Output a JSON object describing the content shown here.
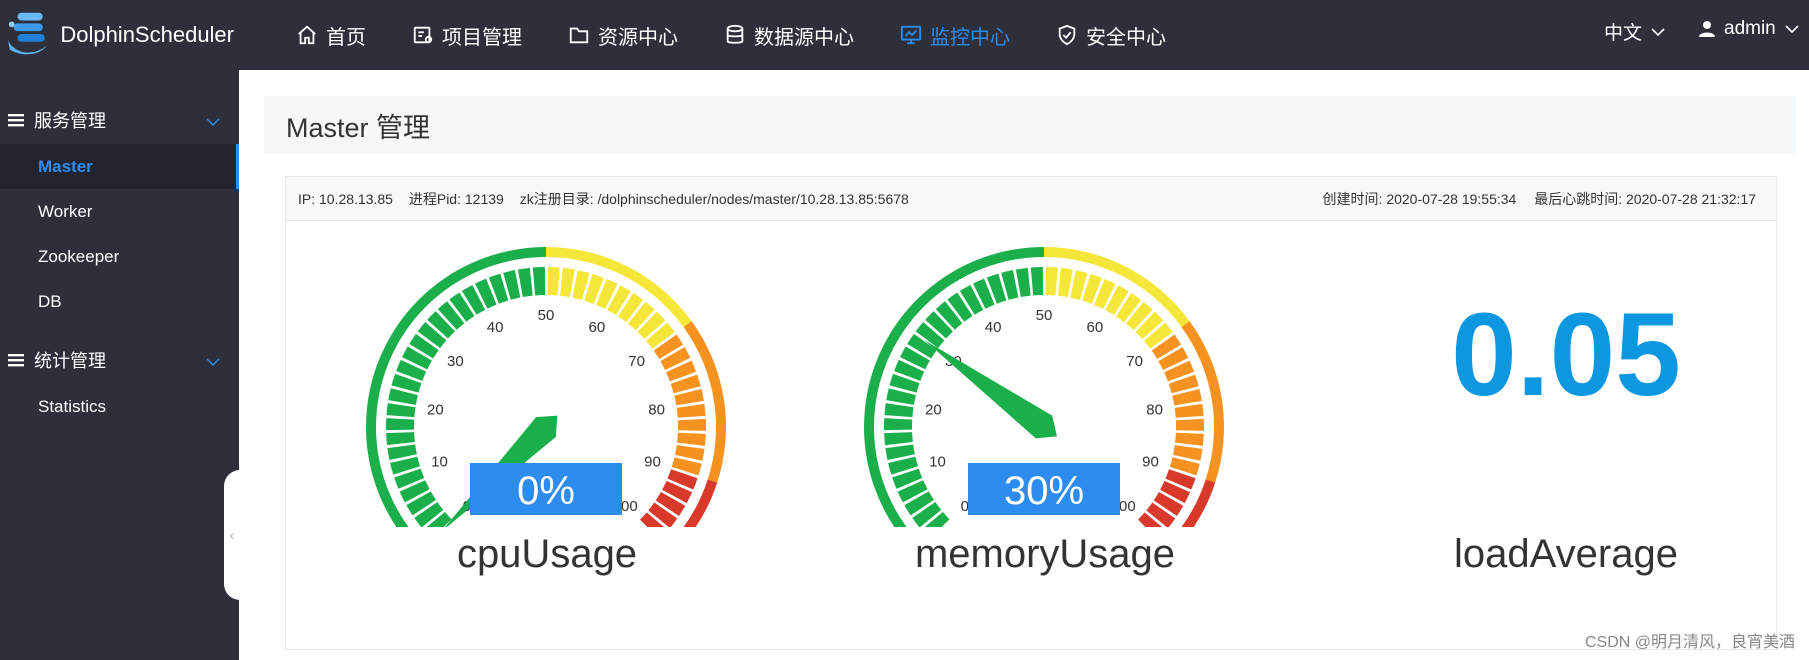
{
  "app": {
    "name": "DolphinScheduler"
  },
  "nav": [
    {
      "label": "首页",
      "icon": "home-icon",
      "active": false
    },
    {
      "label": "项目管理",
      "icon": "project-icon",
      "active": false
    },
    {
      "label": "资源中心",
      "icon": "folder-icon",
      "active": false
    },
    {
      "label": "数据源中心",
      "icon": "database-icon",
      "active": false
    },
    {
      "label": "监控中心",
      "icon": "monitor-icon",
      "active": true
    },
    {
      "label": "安全中心",
      "icon": "shield-icon",
      "active": false
    }
  ],
  "header_right": {
    "language": "中文",
    "user": "admin"
  },
  "sidebar": {
    "group1": {
      "label": "服务管理",
      "items": [
        "Master",
        "Worker",
        "Zookeeper",
        "DB"
      ]
    },
    "group2": {
      "label": "统计管理",
      "items": [
        "Statistics"
      ]
    }
  },
  "page": {
    "title": "Master 管理"
  },
  "server": {
    "ip": "IP: 10.28.13.85",
    "pid": "进程Pid: 12139",
    "zk": "zk注册目录: /dolphinscheduler/nodes/master/10.28.13.85:5678",
    "created": "创建时间: 2020-07-28 19:55:34",
    "heartbeat": "最后心跳时间: 2020-07-28 21:32:17"
  },
  "gauges": [
    {
      "name": "cpuUsage",
      "value": 0,
      "display": "0%"
    },
    {
      "name": "memoryUsage",
      "value": 30,
      "display": "30%"
    }
  ],
  "gauge_ticks": [
    "0",
    "10",
    "20",
    "30",
    "40",
    "50",
    "60",
    "70",
    "80",
    "90",
    "100"
  ],
  "load": {
    "name": "loadAverage",
    "value": "0.05"
  },
  "colors": {
    "accent": "#2d8cf0",
    "load_value": "#0c97e0",
    "green": "#1aaf4b",
    "yellow": "#f5e63a",
    "orange": "#f69320",
    "red": "#d9392a",
    "value_box": "#2d8cf0"
  },
  "watermark": "CSDN @明月清风，良宵美酒"
}
